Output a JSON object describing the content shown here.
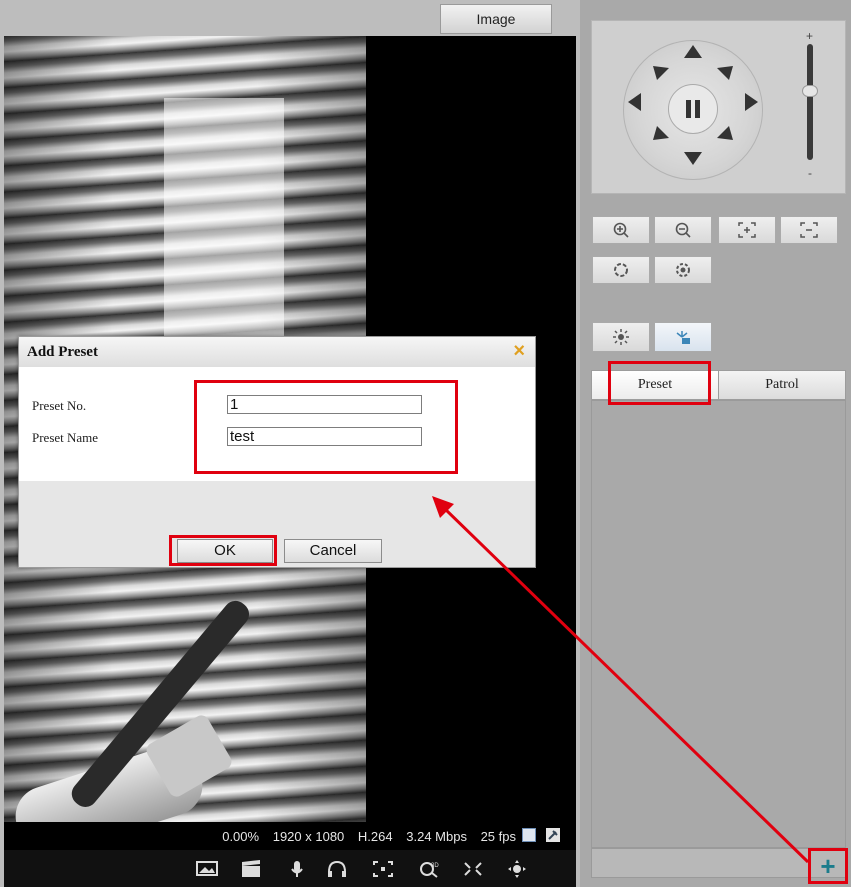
{
  "header": {
    "image_tab": "Image"
  },
  "video": {
    "stats": {
      "zoom": "0.00%",
      "resolution": "1920 x 1080",
      "codec": "H.264",
      "bitrate": "3.24 Mbps",
      "framerate": "25 fps"
    }
  },
  "toolbar": {
    "icons": [
      "snapshot-icon",
      "record-icon",
      "microphone-icon",
      "audio-icon",
      "focus-region-icon",
      "3d-zoom-icon",
      "fullscreen-icon",
      "ptz-icon"
    ]
  },
  "ptz": {
    "zoom_scale_plus": "+",
    "zoom_scale_minus": "-"
  },
  "tabs": {
    "preset": "Preset",
    "patrol": "Patrol"
  },
  "dialog": {
    "title": "Add Preset",
    "preset_no_label": "Preset No.",
    "preset_no_value": "1",
    "preset_name_label": "Preset Name",
    "preset_name_value": "test",
    "ok_label": "OK",
    "cancel_label": "Cancel"
  },
  "add_button": "+",
  "colors": {
    "annotation_red": "#e0000f",
    "add_icon": "#1b7c8c",
    "close_icon": "#e0a020"
  }
}
